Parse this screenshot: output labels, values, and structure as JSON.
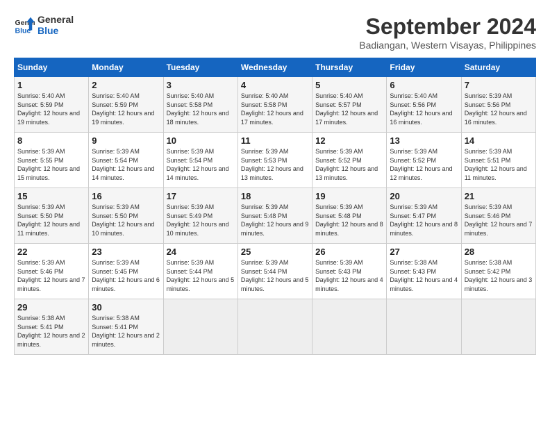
{
  "header": {
    "logo_line1": "General",
    "logo_line2": "Blue",
    "month_title": "September 2024",
    "location": "Badiangan, Western Visayas, Philippines"
  },
  "calendar": {
    "days_of_week": [
      "Sunday",
      "Monday",
      "Tuesday",
      "Wednesday",
      "Thursday",
      "Friday",
      "Saturday"
    ],
    "weeks": [
      [
        null,
        {
          "day": "2",
          "sunrise": "Sunrise: 5:40 AM",
          "sunset": "Sunset: 5:59 PM",
          "daylight": "Daylight: 12 hours and 19 minutes."
        },
        {
          "day": "3",
          "sunrise": "Sunrise: 5:40 AM",
          "sunset": "Sunset: 5:58 PM",
          "daylight": "Daylight: 12 hours and 18 minutes."
        },
        {
          "day": "4",
          "sunrise": "Sunrise: 5:40 AM",
          "sunset": "Sunset: 5:58 PM",
          "daylight": "Daylight: 12 hours and 17 minutes."
        },
        {
          "day": "5",
          "sunrise": "Sunrise: 5:40 AM",
          "sunset": "Sunset: 5:57 PM",
          "daylight": "Daylight: 12 hours and 17 minutes."
        },
        {
          "day": "6",
          "sunrise": "Sunrise: 5:40 AM",
          "sunset": "Sunset: 5:56 PM",
          "daylight": "Daylight: 12 hours and 16 minutes."
        },
        {
          "day": "7",
          "sunrise": "Sunrise: 5:39 AM",
          "sunset": "Sunset: 5:56 PM",
          "daylight": "Daylight: 12 hours and 16 minutes."
        }
      ],
      [
        {
          "day": "1",
          "sunrise": "Sunrise: 5:40 AM",
          "sunset": "Sunset: 5:59 PM",
          "daylight": "Daylight: 12 hours and 19 minutes."
        },
        null,
        null,
        null,
        null,
        null,
        null
      ],
      [
        {
          "day": "8",
          "sunrise": "Sunrise: 5:39 AM",
          "sunset": "Sunset: 5:55 PM",
          "daylight": "Daylight: 12 hours and 15 minutes."
        },
        {
          "day": "9",
          "sunrise": "Sunrise: 5:39 AM",
          "sunset": "Sunset: 5:54 PM",
          "daylight": "Daylight: 12 hours and 14 minutes."
        },
        {
          "day": "10",
          "sunrise": "Sunrise: 5:39 AM",
          "sunset": "Sunset: 5:54 PM",
          "daylight": "Daylight: 12 hours and 14 minutes."
        },
        {
          "day": "11",
          "sunrise": "Sunrise: 5:39 AM",
          "sunset": "Sunset: 5:53 PM",
          "daylight": "Daylight: 12 hours and 13 minutes."
        },
        {
          "day": "12",
          "sunrise": "Sunrise: 5:39 AM",
          "sunset": "Sunset: 5:52 PM",
          "daylight": "Daylight: 12 hours and 13 minutes."
        },
        {
          "day": "13",
          "sunrise": "Sunrise: 5:39 AM",
          "sunset": "Sunset: 5:52 PM",
          "daylight": "Daylight: 12 hours and 12 minutes."
        },
        {
          "day": "14",
          "sunrise": "Sunrise: 5:39 AM",
          "sunset": "Sunset: 5:51 PM",
          "daylight": "Daylight: 12 hours and 11 minutes."
        }
      ],
      [
        {
          "day": "15",
          "sunrise": "Sunrise: 5:39 AM",
          "sunset": "Sunset: 5:50 PM",
          "daylight": "Daylight: 12 hours and 11 minutes."
        },
        {
          "day": "16",
          "sunrise": "Sunrise: 5:39 AM",
          "sunset": "Sunset: 5:50 PM",
          "daylight": "Daylight: 12 hours and 10 minutes."
        },
        {
          "day": "17",
          "sunrise": "Sunrise: 5:39 AM",
          "sunset": "Sunset: 5:49 PM",
          "daylight": "Daylight: 12 hours and 10 minutes."
        },
        {
          "day": "18",
          "sunrise": "Sunrise: 5:39 AM",
          "sunset": "Sunset: 5:48 PM",
          "daylight": "Daylight: 12 hours and 9 minutes."
        },
        {
          "day": "19",
          "sunrise": "Sunrise: 5:39 AM",
          "sunset": "Sunset: 5:48 PM",
          "daylight": "Daylight: 12 hours and 8 minutes."
        },
        {
          "day": "20",
          "sunrise": "Sunrise: 5:39 AM",
          "sunset": "Sunset: 5:47 PM",
          "daylight": "Daylight: 12 hours and 8 minutes."
        },
        {
          "day": "21",
          "sunrise": "Sunrise: 5:39 AM",
          "sunset": "Sunset: 5:46 PM",
          "daylight": "Daylight: 12 hours and 7 minutes."
        }
      ],
      [
        {
          "day": "22",
          "sunrise": "Sunrise: 5:39 AM",
          "sunset": "Sunset: 5:46 PM",
          "daylight": "Daylight: 12 hours and 7 minutes."
        },
        {
          "day": "23",
          "sunrise": "Sunrise: 5:39 AM",
          "sunset": "Sunset: 5:45 PM",
          "daylight": "Daylight: 12 hours and 6 minutes."
        },
        {
          "day": "24",
          "sunrise": "Sunrise: 5:39 AM",
          "sunset": "Sunset: 5:44 PM",
          "daylight": "Daylight: 12 hours and 5 minutes."
        },
        {
          "day": "25",
          "sunrise": "Sunrise: 5:39 AM",
          "sunset": "Sunset: 5:44 PM",
          "daylight": "Daylight: 12 hours and 5 minutes."
        },
        {
          "day": "26",
          "sunrise": "Sunrise: 5:39 AM",
          "sunset": "Sunset: 5:43 PM",
          "daylight": "Daylight: 12 hours and 4 minutes."
        },
        {
          "day": "27",
          "sunrise": "Sunrise: 5:38 AM",
          "sunset": "Sunset: 5:43 PM",
          "daylight": "Daylight: 12 hours and 4 minutes."
        },
        {
          "day": "28",
          "sunrise": "Sunrise: 5:38 AM",
          "sunset": "Sunset: 5:42 PM",
          "daylight": "Daylight: 12 hours and 3 minutes."
        }
      ],
      [
        {
          "day": "29",
          "sunrise": "Sunrise: 5:38 AM",
          "sunset": "Sunset: 5:41 PM",
          "daylight": "Daylight: 12 hours and 2 minutes."
        },
        {
          "day": "30",
          "sunrise": "Sunrise: 5:38 AM",
          "sunset": "Sunset: 5:41 PM",
          "daylight": "Daylight: 12 hours and 2 minutes."
        },
        null,
        null,
        null,
        null,
        null
      ]
    ]
  }
}
